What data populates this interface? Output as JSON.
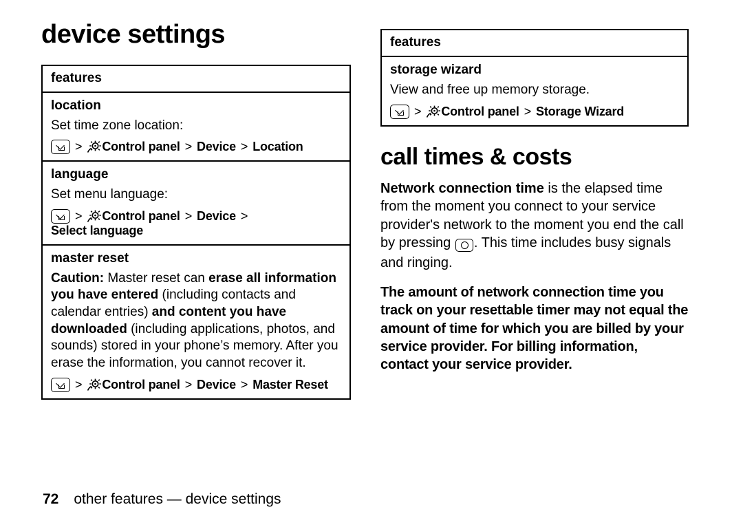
{
  "left": {
    "page_title": "device settings",
    "features_header": "features",
    "entries": [
      {
        "title": "location",
        "desc": "Set time zone location:",
        "path": [
          "Control panel",
          "Device",
          "Location"
        ]
      },
      {
        "title": "language",
        "desc": "Set menu language:",
        "path": [
          "Control panel",
          "Device",
          "Select language"
        ]
      },
      {
        "title": "master reset",
        "caution": {
          "label": "Caution:",
          "t1": " Master reset can ",
          "b1": "erase all information you have entered",
          "t2": " (including contacts and calendar entries) ",
          "b2": "and content you have downloaded",
          "t3": " (including applications, photos, and sounds) stored in your phone’s memory. After you erase the information, you cannot recover it."
        },
        "path": [
          "Control panel",
          "Device",
          "Master Reset"
        ]
      }
    ]
  },
  "right": {
    "features_header": "features",
    "storage": {
      "title": "storage wizard",
      "desc": "View and free up memory storage.",
      "path": [
        "Control panel",
        "Storage Wizard"
      ]
    },
    "section_title": "call times & costs",
    "para1": {
      "b1": "Network connection time",
      "t1": " is the elapsed time from the moment you connect to your service provider's network to the moment you end the call by pressing ",
      "t2": ". This time includes busy signals and ringing."
    },
    "para2": "The amount of network connection time you track on your resettable timer may not equal the amount of time for which you are billed by your service provider. For billing information, contact your service provider."
  },
  "footer": {
    "page_number": "72",
    "text": "other features — device settings"
  },
  "icons": {
    "home": "home-key-icon",
    "control": "control-panel-icon",
    "end": "end-call-key-icon",
    "separator": ">"
  }
}
